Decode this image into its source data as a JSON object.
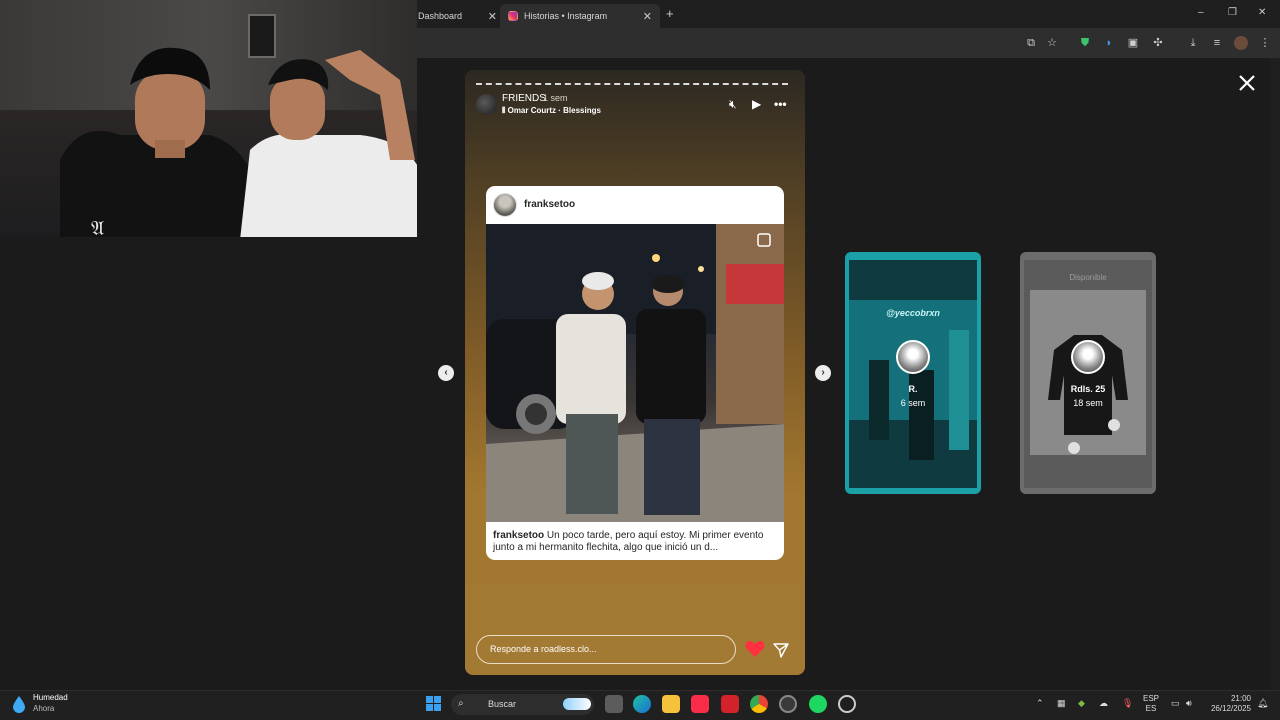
{
  "browser": {
    "tabs": [
      {
        "label": "Dashboard",
        "active": false
      },
      {
        "label": "Historias • Instagram",
        "active": true
      }
    ],
    "new_tab": "+",
    "window_controls": [
      "–",
      "❐",
      "✕"
    ]
  },
  "story": {
    "username": "FRIENDS",
    "time": "1 sem",
    "music": "Omar Courtz · Blessings",
    "post": {
      "username": "franksetoo",
      "caption_user": "franksetoo",
      "caption_text": "Un poco tarde, pero aquí estoy. Mi primer evento junto a mi hermanito flechita, algo que inició un d..."
    },
    "reply_placeholder": "Responde a roadless.clo...",
    "accent_like": "#ff3040"
  },
  "next_stories": [
    {
      "name": "R.",
      "time": "6 sem",
      "overlay_text": "@yeccobrxn",
      "color": "#1aa0a6"
    },
    {
      "name": "Rdls. 25",
      "time": "18 sem",
      "overlay_text": "Disponible",
      "color": "#6c6c6c"
    }
  ],
  "taskbar": {
    "weather_title": "Humedad",
    "weather_sub": "Ahora",
    "search_label": "Buscar",
    "lang_line1": "ESP",
    "lang_line2": "ES",
    "time": "21:00",
    "date": "26/12/2025"
  }
}
